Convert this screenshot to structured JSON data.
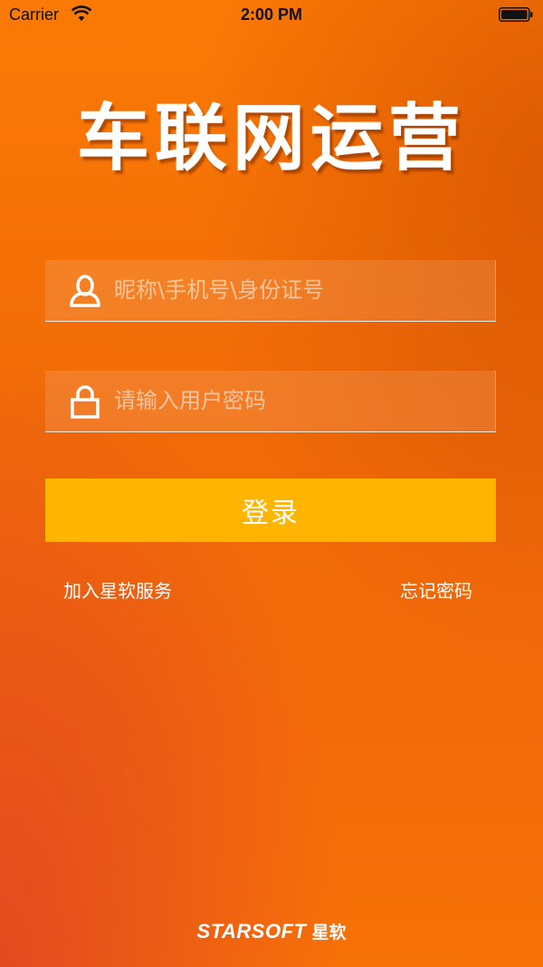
{
  "status_bar": {
    "carrier": "Carrier",
    "time": "2:00 PM",
    "wifi_icon": "wifi-icon",
    "battery_icon": "battery-icon"
  },
  "app": {
    "title": "车联网运营"
  },
  "login_form": {
    "username_placeholder": "昵称\\手机号\\身份证号",
    "username_value": "",
    "username_icon": "user-icon",
    "password_placeholder": "请输入用户密码",
    "password_value": "",
    "password_icon": "lock-icon",
    "login_label": "登录",
    "join_label": "加入星软服务",
    "forgot_label": "忘记密码"
  },
  "footer": {
    "brand": "STARSOFT",
    "brand_cn": "星软"
  },
  "colors": {
    "background": "#f47008",
    "button": "#ffb500",
    "text": "#ffffff"
  }
}
